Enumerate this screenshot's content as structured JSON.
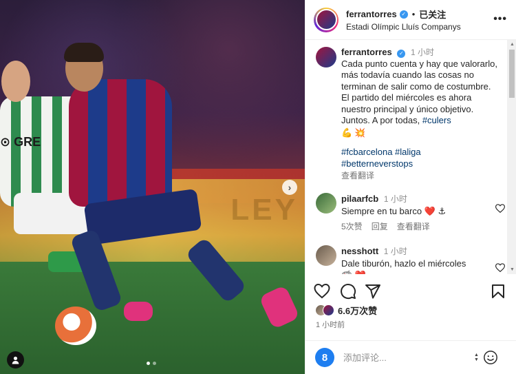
{
  "post": {
    "carousel": {
      "next_label": "›",
      "dots": 2,
      "active_dot": 0
    },
    "photo_board_text": "LEY"
  },
  "header": {
    "username": "ferrantorres",
    "verified_glyph": "✓",
    "separator": "•",
    "follow_state": "已关注",
    "location": "Estadi Olímpic Lluís Companys",
    "more_label": "•••"
  },
  "caption": {
    "username": "ferrantorres",
    "time": "1 小时",
    "text": "Cada punto cuenta y hay que valorarlo, más todavía cuando las cosas no terminan de salir como de costumbre. El partido del miércoles es ahora nuestro principal y único objetivo. Juntos. A por todas,",
    "inline_tag": "#culers",
    "emojis": [
      "💪",
      "💥"
    ],
    "tags_line1": "#fcbarcelona #laliga",
    "tags_line2": "#betterneverstops",
    "translate": "查看翻译"
  },
  "comments": [
    {
      "username": "pilaarfcb",
      "time": "1 小时",
      "text": "Siempre en tu barco",
      "emojis": [
        "❤️",
        "⚓"
      ],
      "likes": "5次赞",
      "reply": "回复",
      "translate": "查看翻译"
    },
    {
      "username": "nesshott",
      "time": "1 小时",
      "text": "Dale tiburón, hazlo el miércoles",
      "emojis": [
        "🦈",
        "❤️"
      ]
    }
  ],
  "actions": {
    "like_icon": "heart-icon",
    "comment_icon": "comment-icon",
    "share_icon": "send-icon",
    "save_icon": "bookmark-icon"
  },
  "likes": {
    "count_text": "6.6万次赞"
  },
  "post_time": "1 小时前",
  "add_comment": {
    "emoji_badge": "8",
    "placeholder": "添加评论...",
    "stepper_up": "▲",
    "stepper_down": "▼"
  },
  "colors": {
    "link": "#00376b",
    "verified": "#3897f0",
    "muted": "#737373",
    "heart": "#ed4956"
  }
}
